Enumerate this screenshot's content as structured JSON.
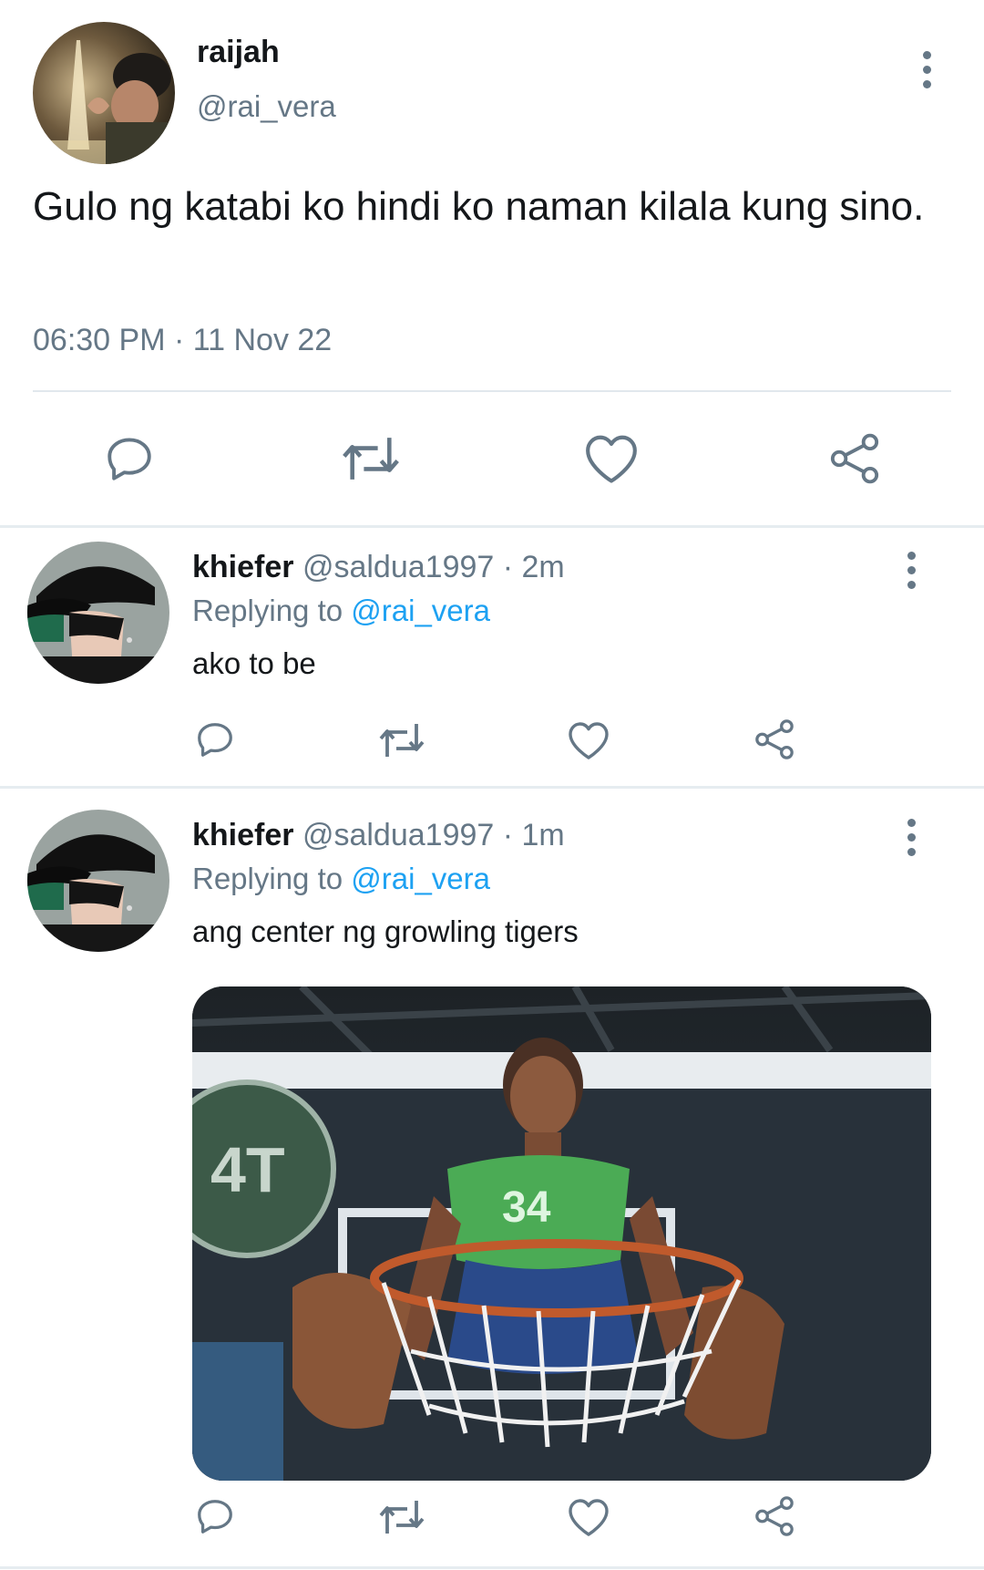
{
  "main_tweet": {
    "name": "raijah",
    "handle": "@rai_vera",
    "text": "Gulo ng katabi ko hindi ko naman kilala kung sino.",
    "timestamp": "06:30 PM · 11 Nov 22",
    "avatar_desc": "avatar",
    "actions": [
      "reply-icon",
      "retweet-icon",
      "like-icon",
      "share-icon"
    ]
  },
  "replies": [
    {
      "name": "khiefer",
      "meta": "@saldua1997 · 2m",
      "replying_prefix": "Replying to ",
      "replying_to": "@rai_vera",
      "text": "ako to be"
    },
    {
      "name": "khiefer",
      "meta": "@saldua1997 · 1m",
      "replying_prefix": "Replying to ",
      "replying_to": "@rai_vera",
      "text": "ang center ng growling tigers",
      "media_jersey": "34"
    }
  ],
  "colors": {
    "text": "#14171a",
    "secondary": "#657786",
    "accent": "#1da1f2",
    "divider": "#e6ecf0"
  }
}
